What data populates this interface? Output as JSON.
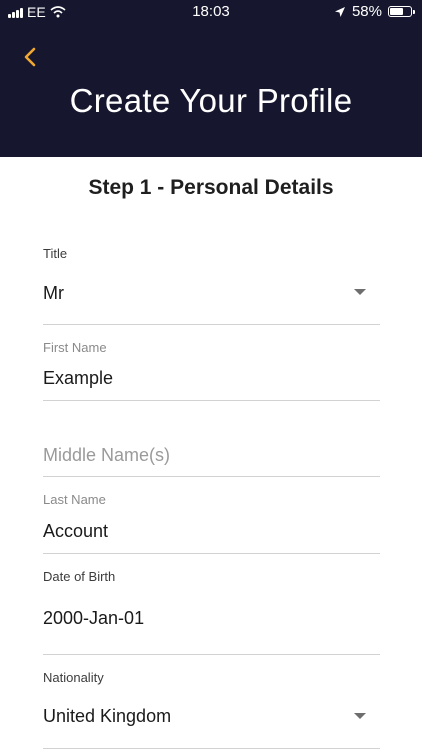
{
  "status_bar": {
    "carrier": "EE",
    "time": "18:03",
    "battery_percent": "58%",
    "battery_level": 0.58,
    "icons": [
      "signal-icon",
      "wifi-icon",
      "location-arrow-icon",
      "battery-icon"
    ]
  },
  "header": {
    "back_icon": "chevron-left-icon",
    "title": "Create Your Profile",
    "background_color": "#16172e",
    "accent_color": "#f0a830"
  },
  "form": {
    "step_title": "Step 1 - Personal Details",
    "title_field": {
      "label": "Title",
      "value": "Mr"
    },
    "first_name": {
      "label": "First Name",
      "value": "Example"
    },
    "middle_name": {
      "placeholder": "Middle Name(s)"
    },
    "last_name": {
      "label": "Last Name",
      "value": "Account"
    },
    "date_of_birth": {
      "label": "Date of Birth",
      "value": "2000-Jan-01"
    },
    "nationality": {
      "label": "Nationality",
      "value": "United Kingdom"
    }
  }
}
